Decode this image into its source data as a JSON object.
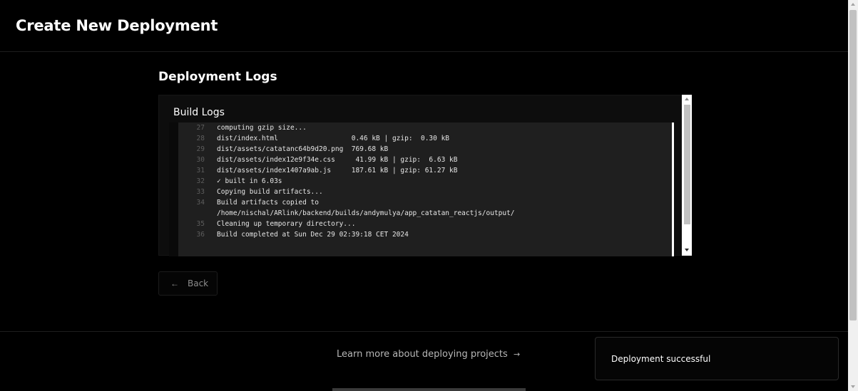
{
  "header": {
    "title": "Create New Deployment"
  },
  "section": {
    "title": "Deployment Logs"
  },
  "logs_card": {
    "title": "Build Logs",
    "lines": [
      {
        "num": "27",
        "text": "computing gzip size..."
      },
      {
        "num": "28",
        "text": "dist/index.html                  0.46 kB | gzip:  0.30 kB"
      },
      {
        "num": "29",
        "text": "dist/assets/catatanc64b9d20.png  769.68 kB"
      },
      {
        "num": "30",
        "text": "dist/assets/index12e9f34e.css     41.99 kB | gzip:  6.63 kB"
      },
      {
        "num": "31",
        "text": "dist/assets/index1407a9ab.js     187.61 kB | gzip: 61.27 kB"
      },
      {
        "num": "32",
        "text": "✓ built in 6.03s"
      },
      {
        "num": "33",
        "text": "Copying build artifacts..."
      },
      {
        "num": "34",
        "text": "Build artifacts copied to"
      },
      {
        "num": "",
        "text": "/home/nischal/ARlink/backend/builds/andymulya/app_catatan_reactjs/output/"
      },
      {
        "num": "35",
        "text": "Cleaning up temporary directory..."
      },
      {
        "num": "36",
        "text": "Build completed at Sun Dec 29 02:39:18 CET 2024"
      }
    ]
  },
  "back_button": {
    "icon": "arrow-left-icon",
    "glyph": "←",
    "label": "Back"
  },
  "footer": {
    "link_text": "Learn more about deploying projects",
    "link_arrow": "→"
  },
  "toast": {
    "message": "Deployment successful"
  },
  "colors": {
    "background": "#000000",
    "log_background": "#1f1f1f",
    "text": "#ffffff",
    "muted": "#8c8c8c"
  }
}
